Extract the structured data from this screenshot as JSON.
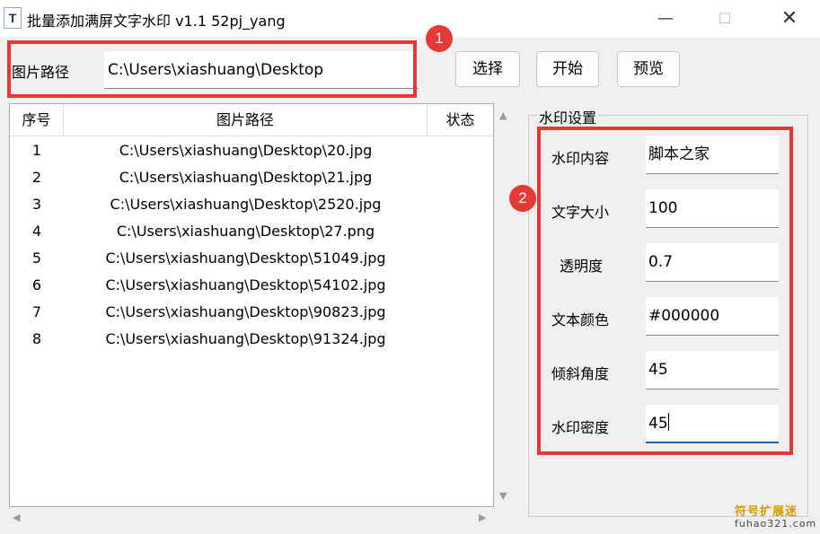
{
  "window": {
    "icon_glyph": "T",
    "title": "批量添加满屏文字水印 v1.1   52pj_yang",
    "min_glyph": "—",
    "max_glyph": "☐",
    "close_glyph": "✕"
  },
  "path": {
    "label": "图片路径",
    "value": "C:\\Users\\xiashuang\\Desktop"
  },
  "buttons": {
    "select": "选择",
    "start": "开始",
    "preview": "预览"
  },
  "annotations": {
    "badge1": "1",
    "badge2": "2"
  },
  "table": {
    "headers": {
      "seq": "序号",
      "path": "图片路径",
      "status": "状态"
    },
    "rows": [
      {
        "seq": "1",
        "path": "C:\\Users\\xiashuang\\Desktop\\20.jpg"
      },
      {
        "seq": "2",
        "path": "C:\\Users\\xiashuang\\Desktop\\21.jpg"
      },
      {
        "seq": "3",
        "path": "C:\\Users\\xiashuang\\Desktop\\2520.jpg"
      },
      {
        "seq": "4",
        "path": "C:\\Users\\xiashuang\\Desktop\\27.png"
      },
      {
        "seq": "5",
        "path": "C:\\Users\\xiashuang\\Desktop\\51049.jpg"
      },
      {
        "seq": "6",
        "path": "C:\\Users\\xiashuang\\Desktop\\54102.jpg"
      },
      {
        "seq": "7",
        "path": "C:\\Users\\xiashuang\\Desktop\\90823.jpg"
      },
      {
        "seq": "8",
        "path": "C:\\Users\\xiashuang\\Desktop\\91324.jpg"
      }
    ]
  },
  "settings": {
    "title": "水印设置",
    "content": {
      "label": "水印内容",
      "value": "脚本之家"
    },
    "font_size": {
      "label": "文字大小",
      "value": "100"
    },
    "opacity": {
      "label": "透明度",
      "value": "0.7"
    },
    "color": {
      "label": "文本颜色",
      "value": "#000000"
    },
    "angle": {
      "label": "倾斜角度",
      "value": "45"
    },
    "density": {
      "label": "水印密度",
      "value": "45"
    }
  },
  "watermark": {
    "line1": "符号扩展迷",
    "line2": "fuhao321.com"
  },
  "colors": {
    "highlight": "#e53935",
    "focus_underline": "#1a5fb4"
  }
}
